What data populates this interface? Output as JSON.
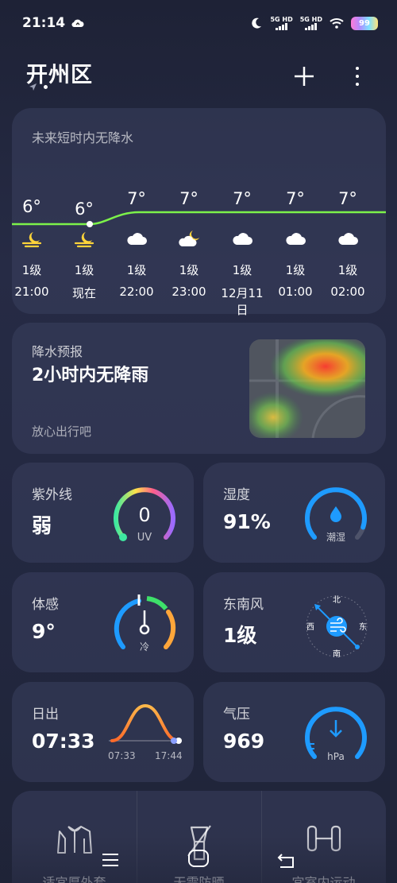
{
  "status_bar": {
    "time": "21:14",
    "sim1": "5G HD",
    "sim2": "5G HD",
    "battery": "99"
  },
  "header": {
    "city": "开州区"
  },
  "hourly": {
    "title": "未来短时内无降水",
    "items": [
      {
        "temp": "6°",
        "icon": "moon-cloud-night-icon",
        "wind": "1级",
        "time": "21:00"
      },
      {
        "temp": "6°",
        "icon": "moon-cloud-night-icon",
        "wind": "1级",
        "time": "现在"
      },
      {
        "temp": "7°",
        "icon": "cloud-icon",
        "wind": "1级",
        "time": "22:00"
      },
      {
        "temp": "7°",
        "icon": "partly-cloudy-night-icon",
        "wind": "1级",
        "time": "23:00"
      },
      {
        "temp": "7°",
        "icon": "cloud-icon",
        "wind": "1级",
        "time": "12月11日"
      },
      {
        "temp": "7°",
        "icon": "cloud-icon",
        "wind": "1级",
        "time": "01:00"
      },
      {
        "temp": "7°",
        "icon": "cloud-icon",
        "wind": "1级",
        "time": "02:00"
      }
    ],
    "line_color": "#7cf24a"
  },
  "precipitation": {
    "label": "降水预报",
    "main": "2小时内无降雨",
    "sub": "放心出行吧"
  },
  "tiles": {
    "uv": {
      "label": "紫外线",
      "value": "弱",
      "gauge_value": "0",
      "gauge_unit": "UV"
    },
    "humidity": {
      "label": "湿度",
      "value": "91%",
      "gauge_text": "潮湿",
      "fill": 0.91
    },
    "feels_like": {
      "label": "体感",
      "value": "9°",
      "gauge_text": "冷"
    },
    "wind": {
      "label": "东南风",
      "value": "1级",
      "north": "北",
      "south": "南",
      "east": "东",
      "west": "西"
    },
    "sunrise": {
      "label": "日出",
      "value": "07:33",
      "rise": "07:33",
      "set": "17:44"
    },
    "pressure": {
      "label": "气压",
      "value": "969",
      "unit": "hPa"
    }
  },
  "bottom": {
    "items": [
      {
        "label": "适宜厚外套",
        "icon": "jacket-icon"
      },
      {
        "label": "无需防晒",
        "icon": "no-sunscreen-icon"
      },
      {
        "label": "宜室内运动",
        "icon": "dumbbell-icon"
      }
    ]
  },
  "colors": {
    "accent_blue": "#1e9bff",
    "temp_line": "#7cf24a"
  }
}
